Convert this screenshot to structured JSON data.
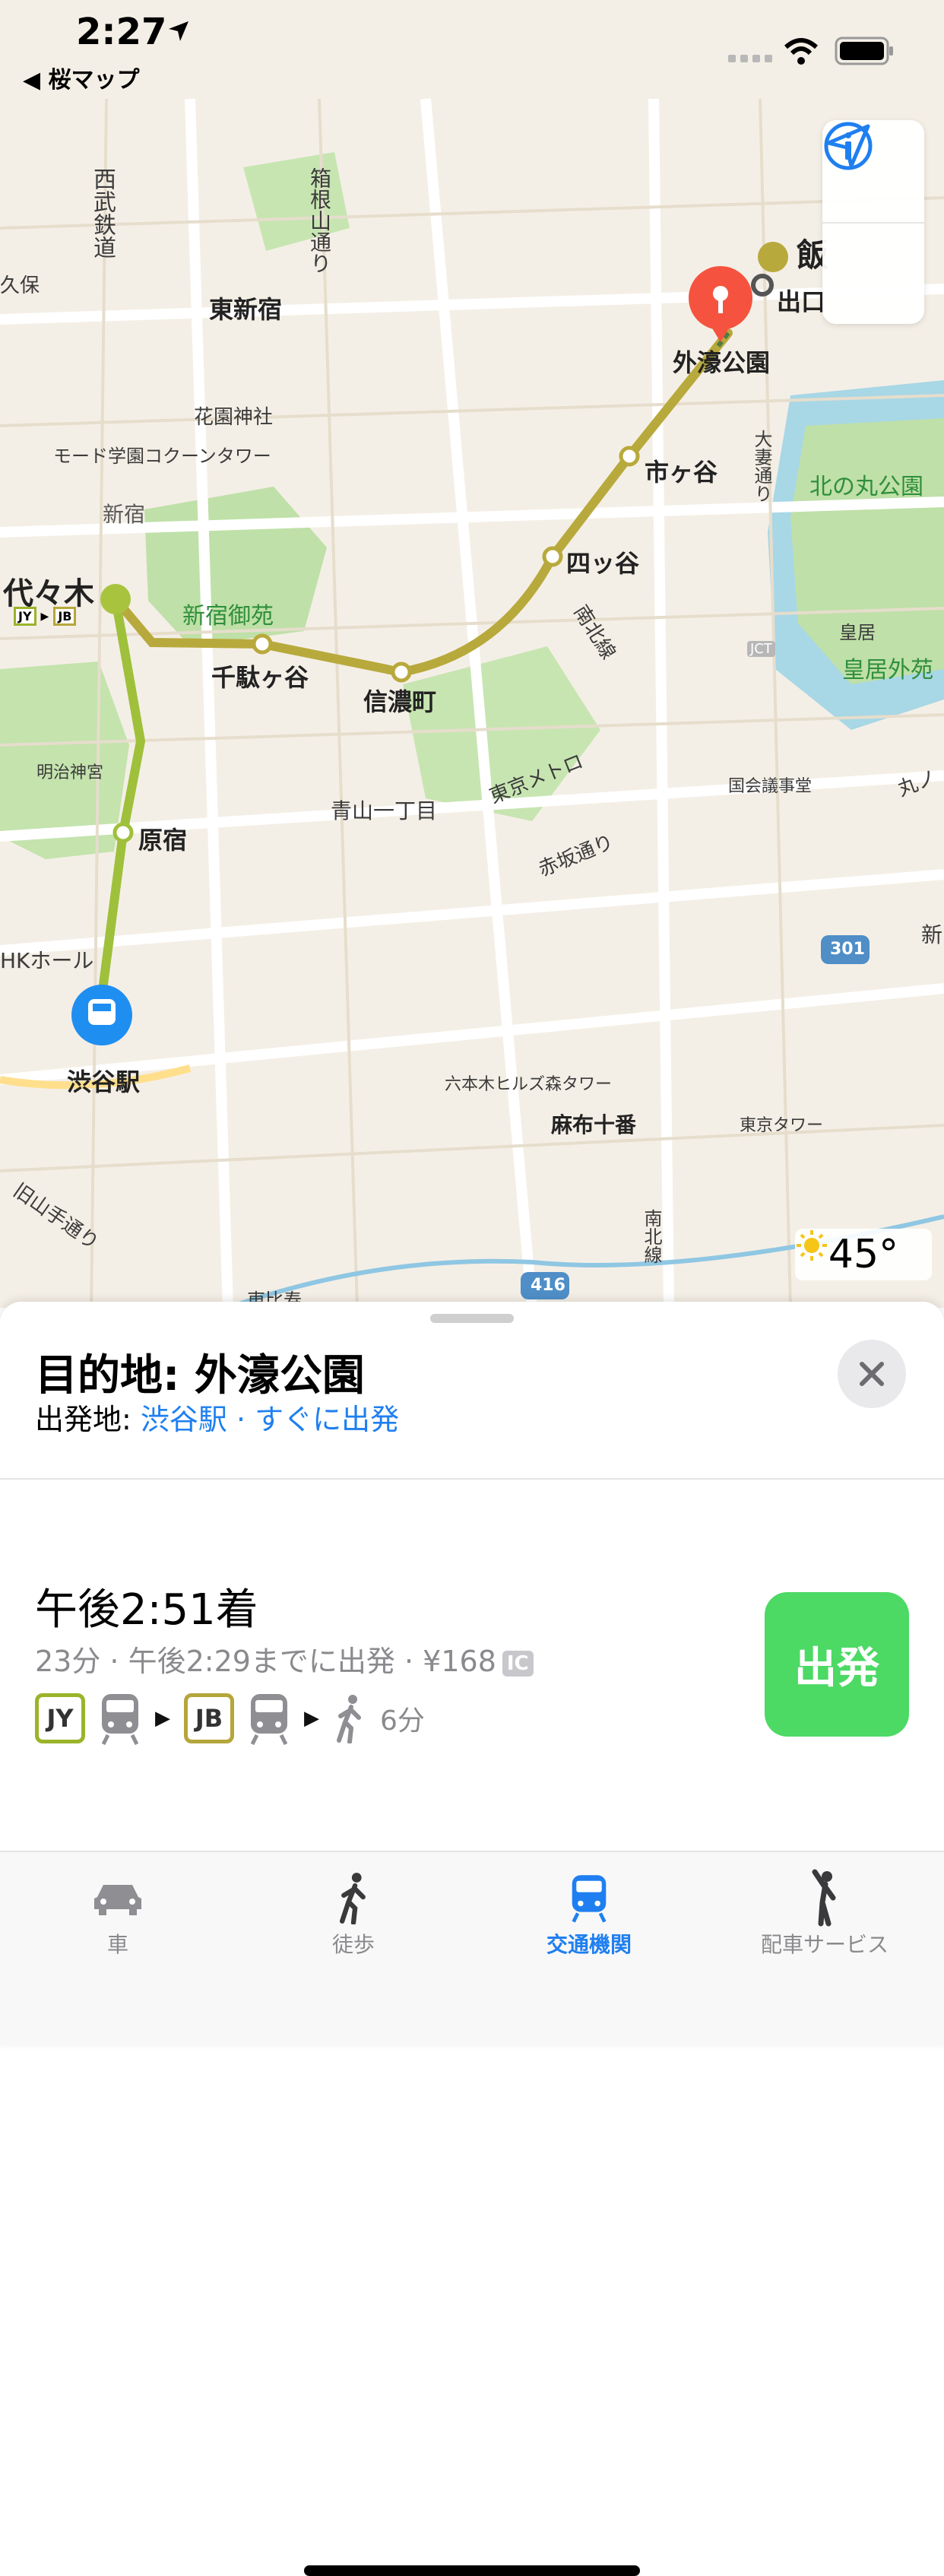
{
  "status": {
    "time": "2:27",
    "back_label": "桜マップ"
  },
  "map": {
    "labels": [
      "西武鉄道",
      "箱根山通り",
      "東新宿",
      "花園神社",
      "モード学園コクーンタワー",
      "新宿",
      "代々木",
      "新宿御苑",
      "千駄ヶ谷",
      "信濃町",
      "四ッ谷",
      "市ヶ谷",
      "外濠公園",
      "飯",
      "出口",
      "北の丸公園",
      "皇居",
      "皇居外苑",
      "大妻通り",
      "南北線",
      "東京メトロ",
      "国会議事堂",
      "丸ノ",
      "明治神宮",
      "原宿",
      "青山一丁目",
      "赤坂通り",
      "HKホール",
      "渋谷駅",
      "六本木ヒルズ森タワー",
      "麻布十番",
      "東京タワー",
      "旧山手通り",
      "南北線",
      "東比寿",
      "新",
      "久保",
      "301",
      "416",
      "JCT"
    ],
    "line_badges": [
      "JY",
      "JB"
    ],
    "weather_temp": "45°"
  },
  "sheet": {
    "destination": "目的地:  外濠公園",
    "origin_label": "出発地: ",
    "origin_station": "渋谷駅",
    "origin_sep": " · ",
    "depart_when": "すぐに出発",
    "arrival": "午後2:51着",
    "details": "23分 · 午後2:29までに出発 · ¥168",
    "ic_label": "IC",
    "steps": {
      "line1": "JY",
      "line2": "JB",
      "walk": "6分"
    },
    "go_label": "出発"
  },
  "tabs": [
    {
      "label": "車",
      "icon": "car-icon"
    },
    {
      "label": "徒歩",
      "icon": "walk-icon"
    },
    {
      "label": "交通機関",
      "icon": "transit-icon"
    },
    {
      "label": "配車サービス",
      "icon": "rideshare-icon"
    }
  ],
  "colors": {
    "accent": "#1f7ff0",
    "go": "#4cd964",
    "jy_line": "#9ab42a",
    "jb_line": "#b5a63b"
  }
}
